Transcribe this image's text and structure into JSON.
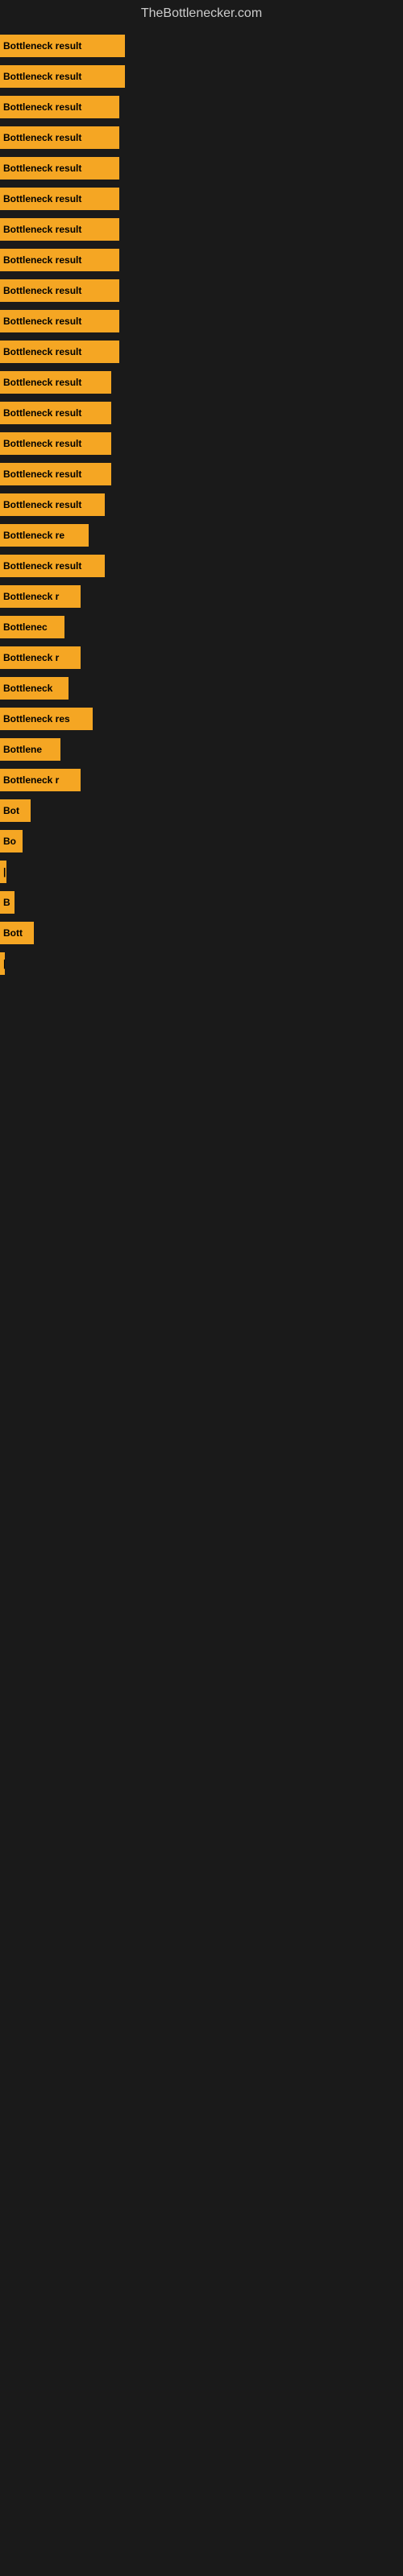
{
  "site": {
    "title": "TheBottlenecker.com"
  },
  "bars": [
    {
      "label": "Bottleneck result",
      "width": 155
    },
    {
      "label": "Bottleneck result",
      "width": 155
    },
    {
      "label": "Bottleneck result",
      "width": 148
    },
    {
      "label": "Bottleneck result",
      "width": 148
    },
    {
      "label": "Bottleneck result",
      "width": 148
    },
    {
      "label": "Bottleneck result",
      "width": 148
    },
    {
      "label": "Bottleneck result",
      "width": 148
    },
    {
      "label": "Bottleneck result",
      "width": 148
    },
    {
      "label": "Bottleneck result",
      "width": 148
    },
    {
      "label": "Bottleneck result",
      "width": 148
    },
    {
      "label": "Bottleneck result",
      "width": 148
    },
    {
      "label": "Bottleneck result",
      "width": 138
    },
    {
      "label": "Bottleneck result",
      "width": 138
    },
    {
      "label": "Bottleneck result",
      "width": 138
    },
    {
      "label": "Bottleneck result",
      "width": 138
    },
    {
      "label": "Bottleneck result",
      "width": 130
    },
    {
      "label": "Bottleneck re",
      "width": 110
    },
    {
      "label": "Bottleneck result",
      "width": 130
    },
    {
      "label": "Bottleneck r",
      "width": 100
    },
    {
      "label": "Bottlenec",
      "width": 80
    },
    {
      "label": "Bottleneck r",
      "width": 100
    },
    {
      "label": "Bottleneck",
      "width": 85
    },
    {
      "label": "Bottleneck res",
      "width": 115
    },
    {
      "label": "Bottlene",
      "width": 75
    },
    {
      "label": "Bottleneck r",
      "width": 100
    },
    {
      "label": "Bot",
      "width": 38
    },
    {
      "label": "Bo",
      "width": 28
    },
    {
      "label": "|",
      "width": 8
    },
    {
      "label": "B",
      "width": 18
    },
    {
      "label": "Bott",
      "width": 42
    },
    {
      "label": "|",
      "width": 6
    }
  ]
}
